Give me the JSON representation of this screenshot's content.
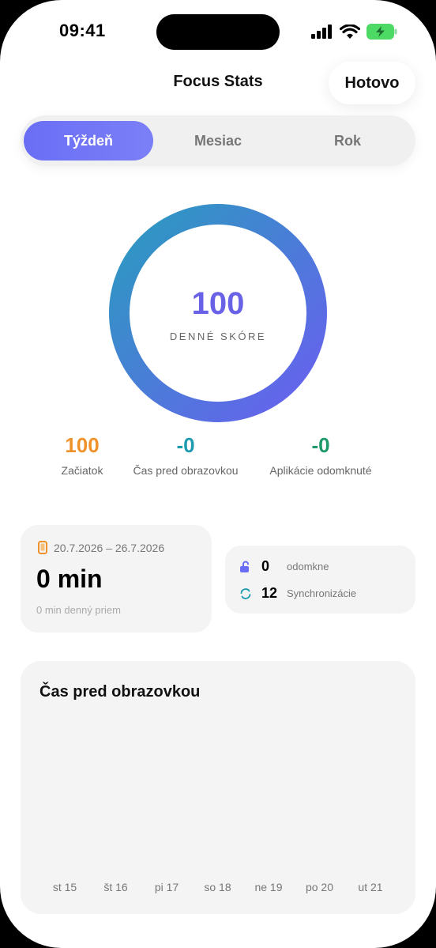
{
  "status": {
    "time": "09:41"
  },
  "header": {
    "title": "Focus Stats",
    "done_label": "Hotovo"
  },
  "segments": {
    "week": "Týždeň",
    "month": "Mesiac",
    "year": "Rok",
    "selected": "week"
  },
  "score": {
    "value": "100",
    "label": "DENNÉ SKÓRE",
    "fraction": 1.0
  },
  "stats": [
    {
      "value": "100",
      "label": "Začiatok",
      "color": "#f0922b"
    },
    {
      "value": "-0",
      "label": "Čas pred obrazovkou",
      "color": "#1f9bb0"
    },
    {
      "value": "-0",
      "label": "Aplikácie odomknuté",
      "color": "#1e9a6a"
    }
  ],
  "week_card": {
    "range": "20.7.2026 – 26.7.2026",
    "total": "0 min",
    "average": "0 min denný priem"
  },
  "unlock_card": {
    "unlocks_value": "0",
    "unlocks_label": "odomkne",
    "sync_value": "12",
    "sync_label": "Synchronizácie"
  },
  "chart": {
    "title": "Čas pred obrazovkou"
  },
  "chart_data": {
    "type": "bar",
    "categories": [
      "st 15",
      "št 16",
      "pi 17",
      "so 18",
      "ne 19",
      "po 20",
      "ut 21"
    ],
    "values": [
      0,
      0,
      0,
      0,
      0,
      0,
      0
    ],
    "xlabel": "",
    "ylabel": ""
  },
  "colors": {
    "accent": "#6a6ef5",
    "ring_start": "#6a5ff0",
    "ring_end": "#2a9bbf"
  }
}
